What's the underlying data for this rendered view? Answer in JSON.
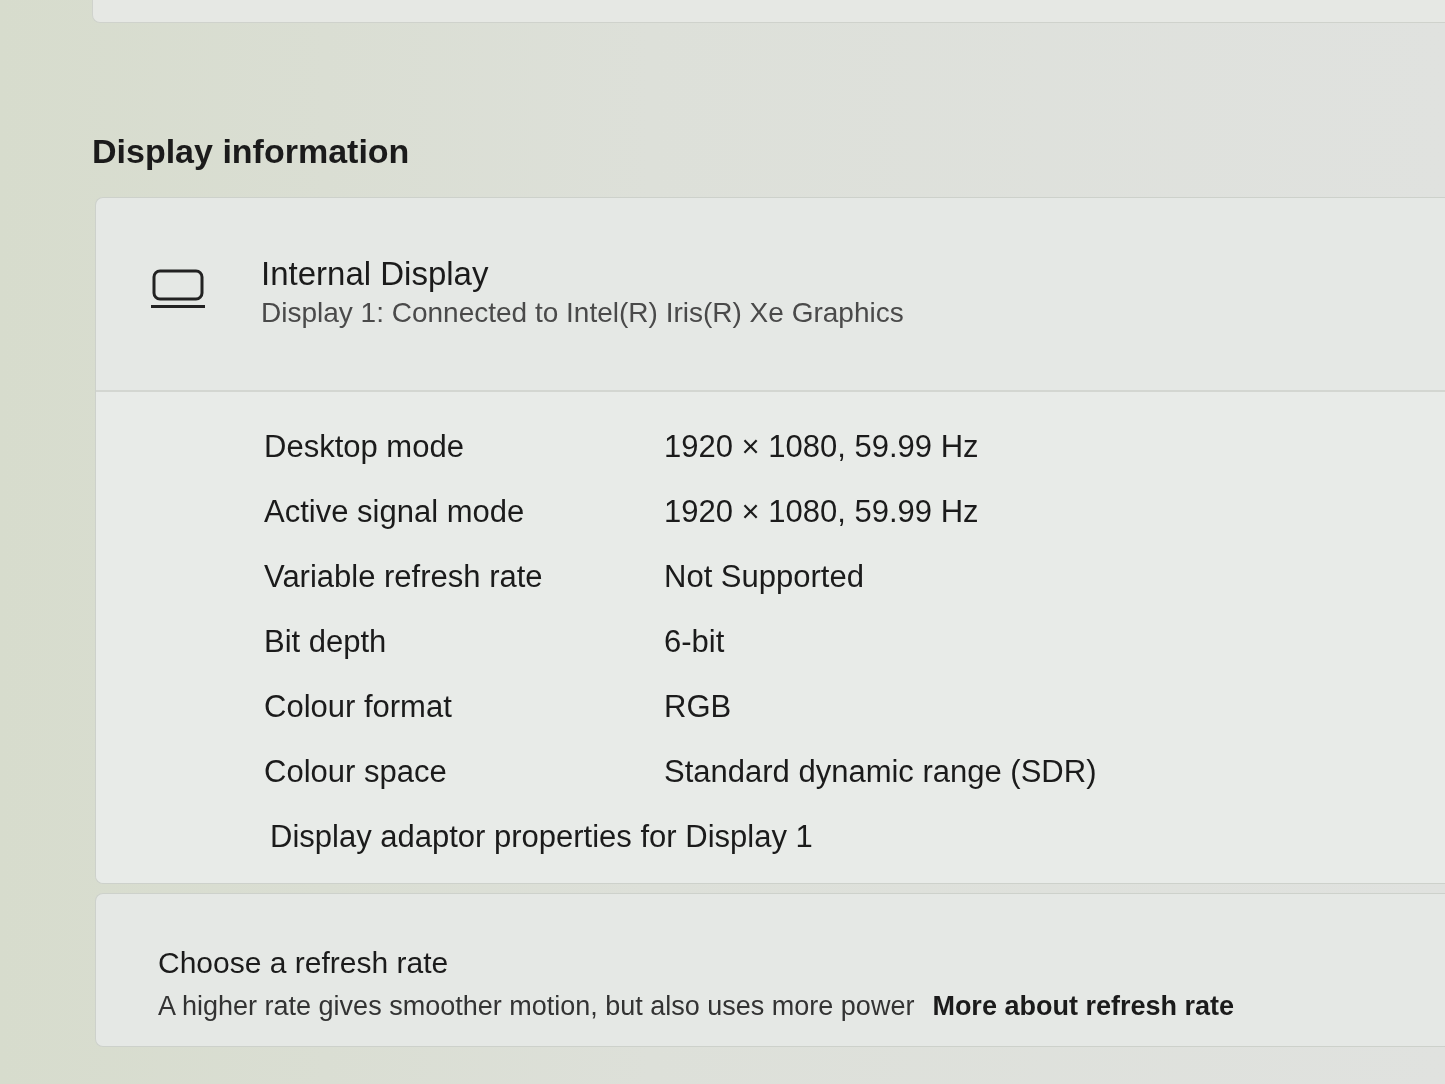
{
  "section_title": "Display information",
  "display": {
    "name": "Internal Display",
    "description": "Display 1: Connected to Intel(R) Iris(R) Xe Graphics",
    "properties": [
      {
        "label": "Desktop mode",
        "value": "1920 × 1080, 59.99 Hz"
      },
      {
        "label": "Active signal mode",
        "value": "1920 × 1080, 59.99 Hz"
      },
      {
        "label": "Variable refresh rate",
        "value": "Not Supported"
      },
      {
        "label": "Bit depth",
        "value": "6-bit"
      },
      {
        "label": "Colour format",
        "value": "RGB"
      },
      {
        "label": "Colour space",
        "value": "Standard dynamic range (SDR)"
      }
    ],
    "adapter_link": "Display adaptor properties for Display 1"
  },
  "refresh_rate": {
    "title": "Choose a refresh rate",
    "description": "A higher rate gives smoother motion, but also uses more power",
    "link": "More about refresh rate"
  }
}
